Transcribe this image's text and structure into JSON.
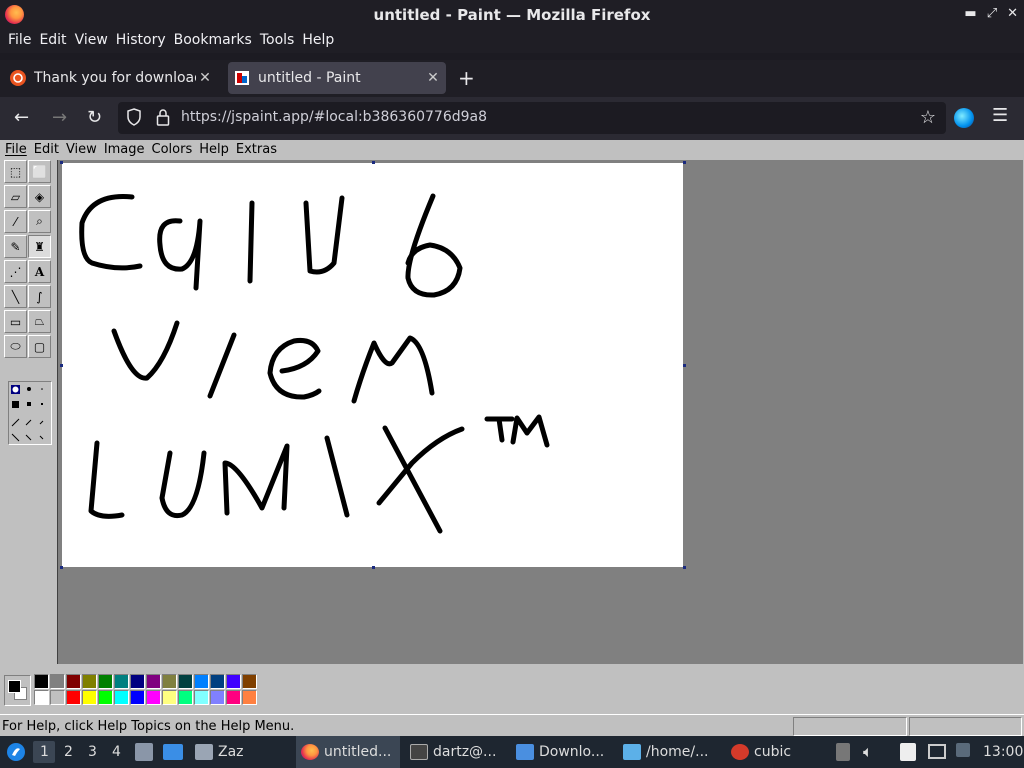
{
  "window": {
    "title": "untitled - Paint — Mozilla Firefox"
  },
  "firefox_menu": [
    "File",
    "Edit",
    "View",
    "History",
    "Bookmarks",
    "Tools",
    "Help"
  ],
  "tabs": [
    {
      "label": "Thank you for downloadi",
      "active": false,
      "icon": "ubuntu-icon"
    },
    {
      "label": "untitled - Paint",
      "active": true,
      "icon": "paint-icon"
    }
  ],
  "address": {
    "url": "https://jspaint.app/#local:b386360776d9a8"
  },
  "paint": {
    "menu": [
      "File",
      "Edit",
      "View",
      "Image",
      "Colors",
      "Help",
      "Extras"
    ],
    "tools": [
      "free-form-select",
      "select",
      "eraser",
      "fill-with-color",
      "pick-color",
      "magnifier",
      "pencil",
      "brush",
      "airbrush",
      "text",
      "line",
      "curve",
      "rectangle",
      "polygon",
      "ellipse",
      "rounded-rectangle"
    ],
    "canvas_text": [
      "Calvb",
      "viem",
      "LUNIX",
      "TM"
    ],
    "foreground_color": "#000000",
    "background_color": "#ffffff",
    "palette_top": [
      "#000000",
      "#808080",
      "#800000",
      "#808000",
      "#008000",
      "#008080",
      "#000080",
      "#800080",
      "#808040",
      "#004040",
      "#0080ff",
      "#004080",
      "#4000ff",
      "#804000"
    ],
    "palette_bottom": [
      "#ffffff",
      "#c0c0c0",
      "#ff0000",
      "#ffff00",
      "#00ff00",
      "#00ffff",
      "#0000ff",
      "#ff00ff",
      "#ffff80",
      "#00ff80",
      "#80ffff",
      "#8080ff",
      "#ff0080",
      "#ff8040"
    ],
    "status_text": "For Help, click Help Topics on the Help Menu."
  },
  "taskbar": {
    "workspaces": [
      "1",
      "2",
      "3",
      "4"
    ],
    "items": [
      {
        "label": "Zaz",
        "icon": "window-icon"
      },
      {
        "label": "untitled...",
        "icon": "firefox-icon"
      },
      {
        "label": "dartz@...",
        "icon": "terminal-icon"
      },
      {
        "label": "Downlo...",
        "icon": "folder-icon"
      },
      {
        "label": "/home/...",
        "icon": "image-viewer-icon"
      },
      {
        "label": "cubic",
        "icon": "cubic-icon"
      }
    ],
    "clock": "13:00"
  }
}
